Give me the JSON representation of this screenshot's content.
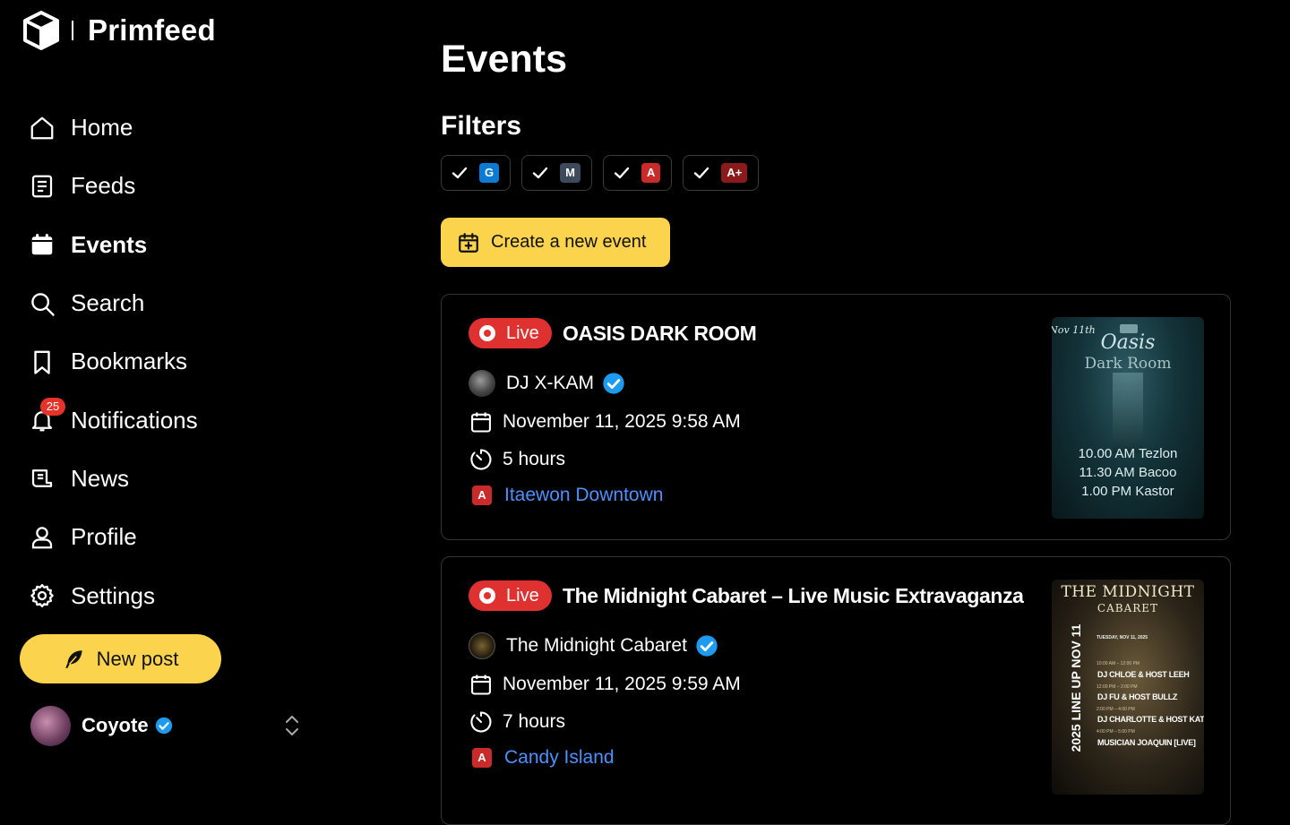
{
  "app": {
    "name": "Primfeed"
  },
  "sidebar": {
    "items": [
      {
        "label": "Home",
        "icon": "home-icon"
      },
      {
        "label": "Feeds",
        "icon": "feeds-icon"
      },
      {
        "label": "Events",
        "icon": "calendar-icon",
        "active": true
      },
      {
        "label": "Search",
        "icon": "search-icon"
      },
      {
        "label": "Bookmarks",
        "icon": "bookmark-icon"
      },
      {
        "label": "Notifications",
        "icon": "bell-icon",
        "badge": "25"
      },
      {
        "label": "News",
        "icon": "news-icon"
      },
      {
        "label": "Profile",
        "icon": "user-icon"
      },
      {
        "label": "Settings",
        "icon": "gear-icon"
      }
    ],
    "new_post_label": "New post",
    "user": {
      "name": "Coyote"
    }
  },
  "main": {
    "title": "Events",
    "filters_title": "Filters",
    "filters": [
      {
        "label": "G",
        "color": "#0b7bd4",
        "checked": true
      },
      {
        "label": "M",
        "color": "#3d4a5c",
        "checked": true
      },
      {
        "label": "A",
        "color": "#c92a2a",
        "checked": true
      },
      {
        "label": "A+",
        "color": "#8b1a1a",
        "checked": true
      }
    ],
    "create_label": "Create a new event"
  },
  "events": [
    {
      "live_label": "Live",
      "title": "OASIS DARK ROOM",
      "host": "DJ X-KAM",
      "date": "November 11, 2025 9:58 AM",
      "duration": "5 hours",
      "rating": "A",
      "location": "Itaewon Downtown",
      "poster": {
        "date_tag": "Nov 11th",
        "title_1": "Oasis",
        "title_2": "Dark Room",
        "lines": [
          "10.00 AM Tezlon",
          "11.30 AM Bacoo",
          "1.00 PM Kastor"
        ]
      }
    },
    {
      "live_label": "Live",
      "title": "The Midnight Cabaret – Live Music Extravaganza",
      "host": "The Midnight Cabaret",
      "date": "November 11, 2025 9:59 AM",
      "duration": "7 hours",
      "rating": "A",
      "location": "Candy Island",
      "poster": {
        "title_1": "THE MIDNIGHT",
        "title_2": "CABARET",
        "side": "2025 LINE UP NOV 11",
        "date_line": "TUESDAY, NOV 11, 2025",
        "lines": [
          {
            "time": "10:00 AM – 12:00 PM",
            "act": "DJ CHLOE & HOST LEEH"
          },
          {
            "time": "12:00 PM – 2:00 PM",
            "act": "DJ FU & HOST BULLZ"
          },
          {
            "time": "2:00 PM – 4:00 PM",
            "act": "DJ CHARLOTTE & HOST KATIE"
          },
          {
            "time": "4:00 PM – 5:00 PM",
            "act": "MUSICIAN JOAQUIN [LIVE]"
          }
        ]
      }
    }
  ]
}
